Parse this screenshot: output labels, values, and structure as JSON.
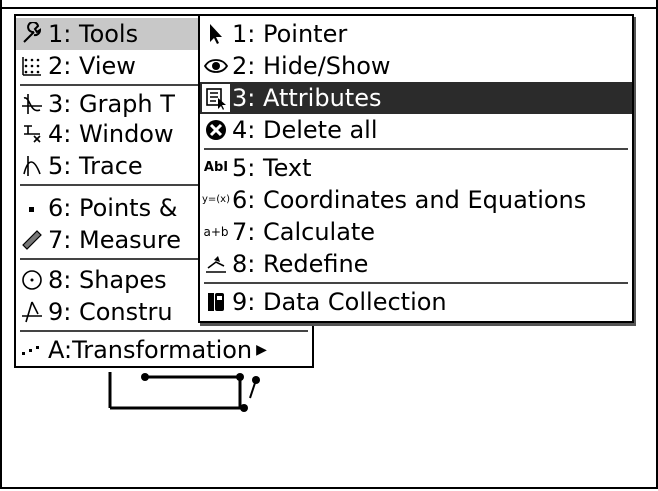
{
  "left_menu": {
    "items": [
      {
        "label": "1: Tools",
        "icon": "wrench-icon"
      },
      {
        "label": "2: View",
        "icon": "grid-icon"
      },
      {
        "label": "3: Graph T",
        "icon": "graph-type-icon"
      },
      {
        "label": "4: Window",
        "icon": "window-zoom-icon"
      },
      {
        "label": "5: Trace",
        "icon": "trace-icon"
      },
      {
        "label": "6: Points &",
        "icon": "point-icon"
      },
      {
        "label": "7: Measure",
        "icon": "ruler-icon"
      },
      {
        "label": "8: Shapes",
        "icon": "circle-shape-icon"
      },
      {
        "label": "9: Constru",
        "icon": "construction-icon"
      },
      {
        "label": "A:Transformation",
        "icon": "transformation-icon"
      }
    ]
  },
  "right_menu": {
    "items": [
      {
        "label": "1: Pointer",
        "icon": "pointer-arrow-icon"
      },
      {
        "label": "2: Hide/Show",
        "icon": "eye-icon"
      },
      {
        "label": "3: Attributes",
        "icon": "attributes-icon"
      },
      {
        "label": "4: Delete all",
        "icon": "delete-all-icon"
      },
      {
        "label": "5: Text",
        "icon": "text-icon",
        "icon_text": "AbI"
      },
      {
        "label": "6: Coordinates and Equations",
        "icon": "coordinates-icon",
        "icon_text": "y=(x)"
      },
      {
        "label": "7: Calculate",
        "icon": "calculate-icon",
        "icon_text": "a+b"
      },
      {
        "label": "8: Redefine",
        "icon": "redefine-icon"
      },
      {
        "label": "9: Data Collection",
        "icon": "data-collection-icon"
      }
    ]
  },
  "colors": {
    "selected_gray": "#c8c8c8",
    "selected_dark": "#2b2b2b"
  }
}
